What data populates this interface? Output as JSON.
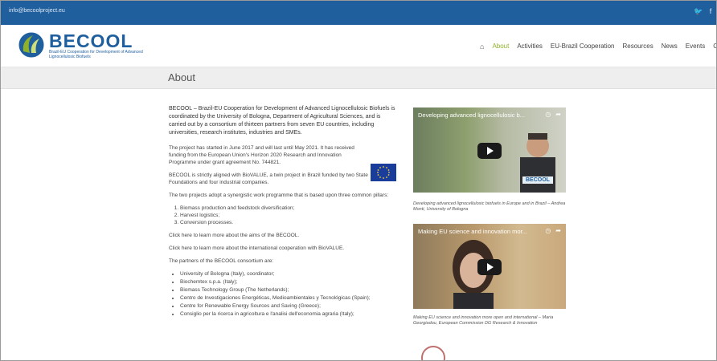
{
  "topbar": {
    "email": "info@becoolproject.eu",
    "social": [
      "twitter-icon",
      "facebook-icon"
    ]
  },
  "logo": {
    "name": "BECOOL",
    "tagline": "Brazil-EU Cooperation for Development of Advanced Lignocellulosic Biofuels"
  },
  "nav": {
    "home_icon": "home-icon",
    "items": [
      "About",
      "Activities",
      "EU-Brazil Cooperation",
      "Resources",
      "News",
      "Events",
      "C"
    ],
    "active_index": 0
  },
  "page": {
    "title": "About"
  },
  "content": {
    "intro": "BECOOL – Brazil-EU Cooperation for Development of Advanced Lignocellulosic Biofuels is coordinated by the University of Bologna, Department of Agricultural Sciences, and is carried out by a consortium of thirteen partners from seven EU countries, including universities, research institutes, industries and SMEs.",
    "funded": "The project has started in June 2017 and will last until May 2021. It has received funding from the European Union's Horizon 2020 Research and Innovation Programme under grant agreement No. 744821.",
    "aligned": "BECOOL is strictly aligned with BioVALUE, a twin project in Brazil funded by two State Foundations and four industrial companies.",
    "twin": "The two projects adopt a synergistic work programme that is based upon three common pillars:",
    "pillars": [
      "Biomass production and feedstock diversification;",
      "Harvest logistics;",
      "Conversion processes."
    ],
    "click_here": "Click here to learn more about the aims of the BECOOL.",
    "click_here2": "Click here to learn more about the international cooperation with BioVALUE.",
    "partners_intro": "The partners of the BECOOL consortium are:",
    "partners": [
      "University of Bologna (Italy), coordinator;",
      "Biochemtex s.p.a. (Italy);",
      "Biomass Technology Group (The Netherlands);",
      "Centro de Investigaciones Energéticas, Medioambientales y Tecnológicas (Spain);",
      "Centre for Renewable Energy Sources and Saving (Greece);",
      "Consiglio per la ricerca in agricoltura e l'analisi dell'economia agraria (Italy);"
    ]
  },
  "videos": [
    {
      "title": "Developing advanced lignocellulosic b...",
      "caption": "Developing advanced lignocellulosic biofuels in Europe and in Brazil – Andrea Monti, University of Bologna",
      "badge": "BECOOL"
    },
    {
      "title": "Making EU science and innovation mor...",
      "caption": "Making EU science and innovation more open and international – Maria Georgiadou, European Commission DG Research & Innovation"
    }
  ]
}
